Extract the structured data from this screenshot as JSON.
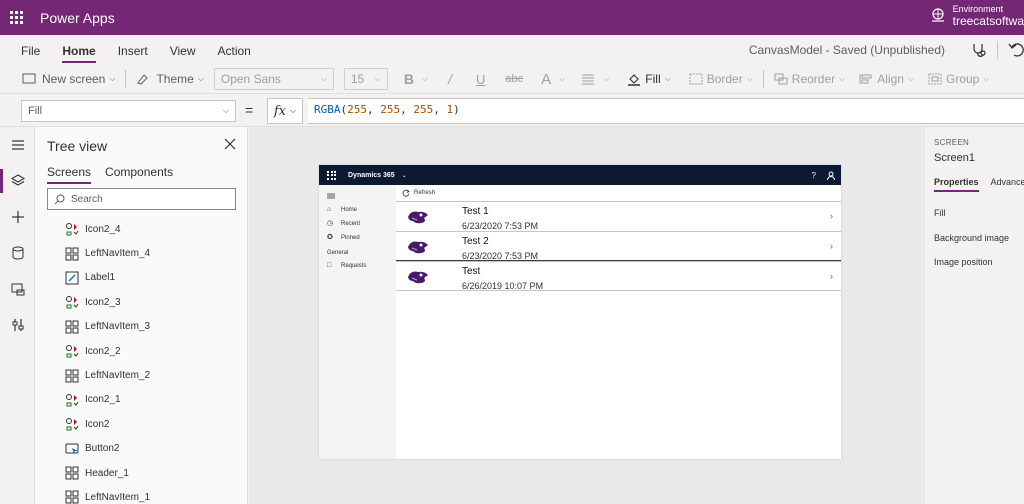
{
  "app": {
    "title": "Power Apps",
    "environment_label": "Environment",
    "environment_name": "treecatsoftwa"
  },
  "menu": {
    "items": [
      "File",
      "Home",
      "Insert",
      "View",
      "Action"
    ],
    "active": "Home",
    "saved_status": "CanvasModel - Saved (Unpublished)"
  },
  "toolbar": {
    "new_screen": "New screen",
    "theme": "Theme",
    "font": "Open Sans",
    "font_size": "15",
    "fill": "Fill",
    "border": "Border",
    "reorder": "Reorder",
    "align": "Align",
    "group": "Group"
  },
  "formula_bar": {
    "property": "Fill",
    "equals": "=",
    "fx": "fx",
    "formula_fn": "RGBA",
    "formula_args": [
      "255",
      "255",
      "255",
      "1"
    ]
  },
  "tree": {
    "title": "Tree view",
    "tabs": [
      "Screens",
      "Components"
    ],
    "search_placeholder": "Search",
    "items": [
      {
        "label": "Icon2_4",
        "icon": "icon-control"
      },
      {
        "label": "LeftNavItem_4",
        "icon": "group-control"
      },
      {
        "label": "Label1",
        "icon": "label-control"
      },
      {
        "label": "Icon2_3",
        "icon": "icon-control"
      },
      {
        "label": "LeftNavItem_3",
        "icon": "group-control"
      },
      {
        "label": "Icon2_2",
        "icon": "icon-control"
      },
      {
        "label": "LeftNavItem_2",
        "icon": "group-control"
      },
      {
        "label": "Icon2_1",
        "icon": "icon-control"
      },
      {
        "label": "Icon2",
        "icon": "icon-control"
      },
      {
        "label": "Button2",
        "icon": "button-control"
      },
      {
        "label": "Header_1",
        "icon": "group-control"
      },
      {
        "label": "LeftNavItem_1",
        "icon": "group-control"
      }
    ]
  },
  "canvas": {
    "header_title": "Dynamics 365",
    "help": "?",
    "left_nav": {
      "items": [
        "Home",
        "Recent",
        "Pinned"
      ],
      "section": "General",
      "section_items": [
        "Requests"
      ]
    },
    "refresh_label": "Refresh",
    "rows": [
      {
        "title": "Test 1",
        "subtitle": "6/23/2020 7:53 PM"
      },
      {
        "title": "Test 2",
        "subtitle": "6/23/2020 7:53 PM"
      },
      {
        "title": "Test",
        "subtitle": "6/26/2019 10:07 PM"
      }
    ]
  },
  "properties": {
    "type": "SCREEN",
    "name": "Screen1",
    "tabs": [
      "Properties",
      "Advanced"
    ],
    "props": [
      "Fill",
      "Background image",
      "Image position"
    ]
  },
  "colors": {
    "brand": "#742774",
    "d365_header": "#0b1a33"
  }
}
